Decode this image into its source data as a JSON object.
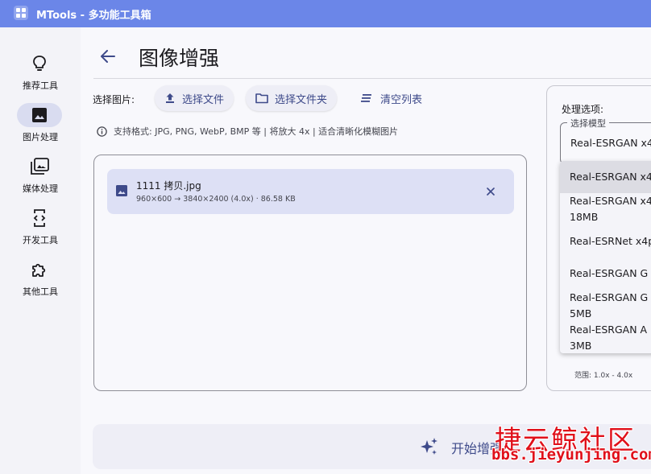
{
  "app": {
    "title": "MTools - 多功能工具箱"
  },
  "sidebar": {
    "items": [
      {
        "label": "推荐工具",
        "icon": "lightbulb-icon"
      },
      {
        "label": "图片处理",
        "icon": "image-icon",
        "active": true
      },
      {
        "label": "媒体处理",
        "icon": "photo-library-icon"
      },
      {
        "label": "开发工具",
        "icon": "developer-mode-icon"
      },
      {
        "label": "其他工具",
        "icon": "extension-icon"
      }
    ]
  },
  "header": {
    "title": "图像增强"
  },
  "toolbar": {
    "select_label": "选择图片:",
    "select_file": "选择文件",
    "select_folder": "选择文件夹",
    "clear_list": "清空列表"
  },
  "info": {
    "text": "支持格式: JPG, PNG, WebP, BMP 等 | 将放大 4x | 适合清晰化模糊图片"
  },
  "files": [
    {
      "name": "1111 拷贝.jpg",
      "meta": "960×600 → 3840×2400 (4.0x) · 86.58 KB"
    }
  ],
  "options": {
    "label": "处理选项:",
    "model_legend": "选择模型",
    "model_value": "Real-ESRGAN x4",
    "range_hint": "范围: 1.0x - 4.0x"
  },
  "dropdown": {
    "items": [
      {
        "line1": "Real-ESRGAN x4",
        "line2": ""
      },
      {
        "line1": "Real-ESRGAN x4",
        "line2": "18MB"
      },
      {
        "line1": "Real-ESRNet x4p",
        "line2": ""
      },
      {
        "line1": "Real-ESRGAN G",
        "line2": ""
      },
      {
        "line1": "Real-ESRGAN G",
        "line2": "5MB"
      },
      {
        "line1": "Real-ESRGAN A",
        "line2": "3MB"
      }
    ]
  },
  "actions": {
    "start": "开始增强"
  },
  "watermark": {
    "cn": "捷云鲸社区",
    "url": "bbs.jieyunjing.com"
  },
  "colors": {
    "titlebar": "#6b86e8",
    "accent": "#3e4a8a",
    "active_pill": "#d9dcf0",
    "file_card": "#dde0f5"
  }
}
